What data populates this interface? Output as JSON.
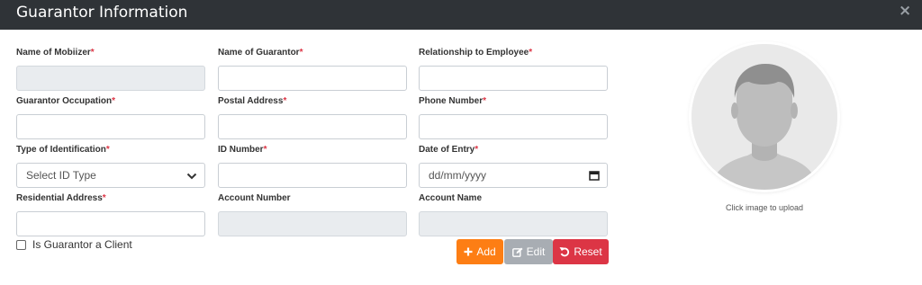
{
  "header": {
    "title": "Guarantor Information",
    "close_glyph": "×"
  },
  "fields": {
    "mobilizer": {
      "label": "Name of Mobiizer",
      "required": "*",
      "value": ""
    },
    "guarantor_name": {
      "label": "Name of Guarantor",
      "required": "*",
      "value": ""
    },
    "relationship": {
      "label": "Relationship to Employee",
      "required": "*",
      "value": ""
    },
    "occupation": {
      "label": "Guarantor Occupation",
      "required": "*",
      "value": ""
    },
    "postal_address": {
      "label": "Postal Address",
      "required": "*",
      "value": ""
    },
    "phone": {
      "label": "Phone Number",
      "required": "*",
      "value": ""
    },
    "id_type": {
      "label": "Type of Identification",
      "required": "*",
      "value": "Select ID Type"
    },
    "id_number": {
      "label": "ID Number",
      "required": "*",
      "value": ""
    },
    "date_of_entry": {
      "label": "Date of Entry",
      "required": "*",
      "placeholder": "dd/mm/yyyy"
    },
    "residential_address": {
      "label": "Residential Address",
      "required": "*",
      "value": ""
    },
    "account_number": {
      "label": "Account Number",
      "value": ""
    },
    "account_name": {
      "label": "Account Name",
      "value": ""
    }
  },
  "checkbox": {
    "label": "Is Guarantor a Client",
    "checked": false
  },
  "buttons": {
    "add": "Add",
    "edit": "Edit",
    "reset": "Reset"
  },
  "photo": {
    "caption": "Click image to upload",
    "icon": "user-avatar-placeholder"
  },
  "colors": {
    "header_bg": "#2f3337",
    "required": "#dc3545",
    "add": "#fd7e14",
    "edit": "#a8adb3",
    "reset": "#dc3545",
    "disabled_input": "#e9ecef"
  }
}
